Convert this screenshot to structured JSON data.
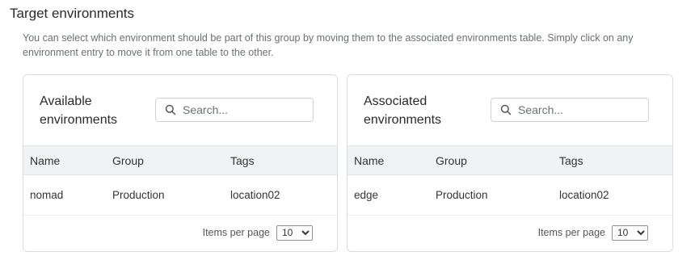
{
  "section": {
    "title": "Target environments",
    "description": "You can select which environment should be part of this group by moving them to the associated environments table. Simply click on any environment entry to move it from one table to the other."
  },
  "available": {
    "title_line1": "Available",
    "title_line2": "environments",
    "search_placeholder": "Search...",
    "columns": [
      "Name",
      "Group",
      "Tags"
    ],
    "rows": [
      {
        "name": "nomad",
        "group": "Production",
        "tags": "location02"
      }
    ],
    "pager_label": "Items per page",
    "page_size": "10",
    "page_size_options": [
      "10"
    ]
  },
  "associated": {
    "title_line1": "Associated",
    "title_line2": "environments",
    "search_placeholder": "Search...",
    "columns": [
      "Name",
      "Group",
      "Tags"
    ],
    "rows": [
      {
        "name": "edge",
        "group": "Production",
        "tags": "location02"
      }
    ],
    "pager_label": "Items per page",
    "page_size": "10",
    "page_size_options": [
      "10"
    ]
  },
  "icons": {
    "search": "search-icon"
  },
  "colors": {
    "header_bg": "#f0f2f4",
    "border": "#d9dcdf",
    "muted_text": "#6b6f73"
  }
}
